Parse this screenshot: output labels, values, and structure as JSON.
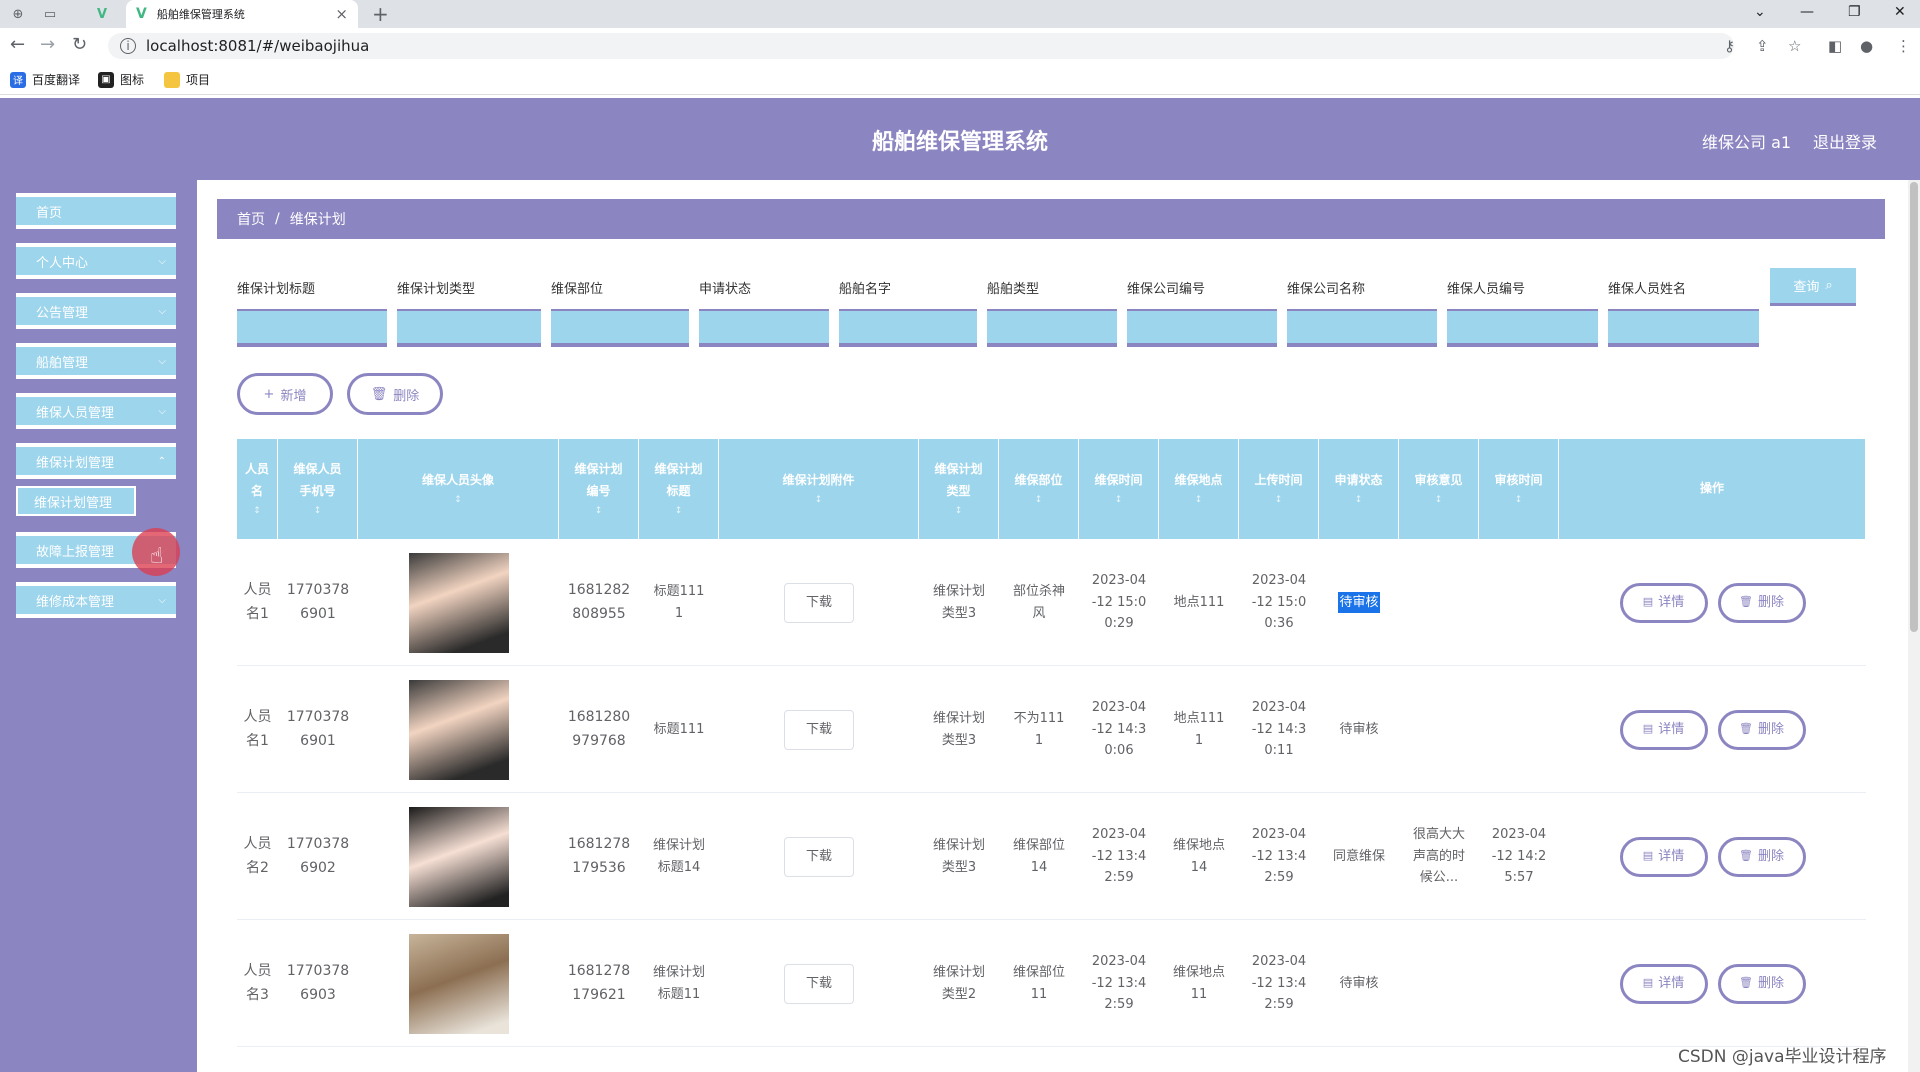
{
  "browser": {
    "tab_title": "船舶维保管理系统",
    "url": "localhost:8081/#/weibaojihua",
    "bookmarks": [
      "百度翻译",
      "图标",
      "项目"
    ]
  },
  "header": {
    "title": "船舶维保管理系统",
    "user": "维保公司 a1",
    "logout": "退出登录"
  },
  "sidebar": {
    "items": [
      {
        "label": "首页",
        "has_chevron": false
      },
      {
        "label": "个人中心",
        "has_chevron": true
      },
      {
        "label": "公告管理",
        "has_chevron": true
      },
      {
        "label": "船舶管理",
        "has_chevron": true
      },
      {
        "label": "维保人员管理",
        "has_chevron": true
      },
      {
        "label": "维保计划管理",
        "has_chevron": true
      },
      {
        "label": "故障上报管理",
        "has_chevron": true
      },
      {
        "label": "维修成本管理",
        "has_chevron": true
      }
    ],
    "sub_item": "维保计划管理"
  },
  "breadcrumb": {
    "home": "首页",
    "separator": "/",
    "current": "维保计划"
  },
  "filters": {
    "labels": [
      "维保计划标题",
      "维保计划类型",
      "维保部位",
      "申请状态",
      "船舶名字",
      "船舶类型",
      "维保公司编号",
      "维保公司名称",
      "维保人员编号",
      "维保人员姓名"
    ],
    "query_button": "查询"
  },
  "actions": {
    "add": "新增",
    "delete": "删除"
  },
  "table": {
    "headers": [
      [
        "人员",
        "名"
      ],
      [
        "维保人员",
        "手机号"
      ],
      [
        "维保人员头像"
      ],
      [
        "维保计划",
        "编号"
      ],
      [
        "维保计划",
        "标题"
      ],
      [
        "维保计划附件"
      ],
      [
        "维保计划",
        "类型"
      ],
      [
        "维保部位"
      ],
      [
        "维保时间"
      ],
      [
        "维保地点"
      ],
      [
        "上传时间"
      ],
      [
        "申请状态"
      ],
      [
        "审核意见"
      ],
      [
        "审核时间"
      ],
      [
        "操作"
      ]
    ],
    "sort_glyph": "↕",
    "download_label": "下载",
    "detail_label": "详情",
    "delete_label": "删除",
    "rows": [
      {
        "name": "人员\n名1",
        "phone": "1770378\n6901",
        "avatar": "m",
        "plan_no": "1681282\n808955",
        "plan_title": "标题111\n1",
        "plan_type": "维保计划\n类型3",
        "part": "部位杀神\n风",
        "time": "2023-04\n-12 15:0\n0:29",
        "place": "地点111",
        "upload": "2023-04\n-12 15:0\n0:36",
        "status": "待审核",
        "status_highlight": true,
        "opinion": "",
        "review_time": ""
      },
      {
        "name": "人员\n名1",
        "phone": "1770378\n6901",
        "avatar": "m",
        "plan_no": "1681280\n979768",
        "plan_title": "标题111",
        "plan_type": "维保计划\n类型3",
        "part": "不为111\n1",
        "time": "2023-04\n-12 14:3\n0:06",
        "place": "地点111\n1",
        "upload": "2023-04\n-12 14:3\n0:11",
        "status": "待审核",
        "status_highlight": false,
        "opinion": "",
        "review_time": ""
      },
      {
        "name": "人员\n名2",
        "phone": "1770378\n6902",
        "avatar": "g",
        "plan_no": "1681278\n179536",
        "plan_title": "维保计划\n标题14",
        "plan_type": "维保计划\n类型3",
        "part": "维保部位\n14",
        "time": "2023-04\n-12 13:4\n2:59",
        "place": "维保地点\n14",
        "upload": "2023-04\n-12 13:4\n2:59",
        "status": "同意维保",
        "status_highlight": false,
        "opinion": "很高大大\n声高的时\n候公...",
        "review_time": "2023-04\n-12 14:2\n5:57"
      },
      {
        "name": "人员\n名3",
        "phone": "1770378\n6903",
        "avatar": "p",
        "plan_no": "1681278\n179621",
        "plan_title": "维保计划\n标题11",
        "plan_type": "维保计划\n类型2",
        "part": "维保部位\n11",
        "time": "2023-04\n-12 13:4\n2:59",
        "place": "维保地点\n11",
        "upload": "2023-04\n-12 13:4\n2:59",
        "status": "待审核",
        "status_highlight": false,
        "opinion": "",
        "review_time": ""
      }
    ]
  },
  "watermark": "CSDN @java毕业设计程序",
  "colors": {
    "primary": "#8b85c1",
    "accent": "#9dd5ec",
    "highlight": "#1a73e8"
  }
}
